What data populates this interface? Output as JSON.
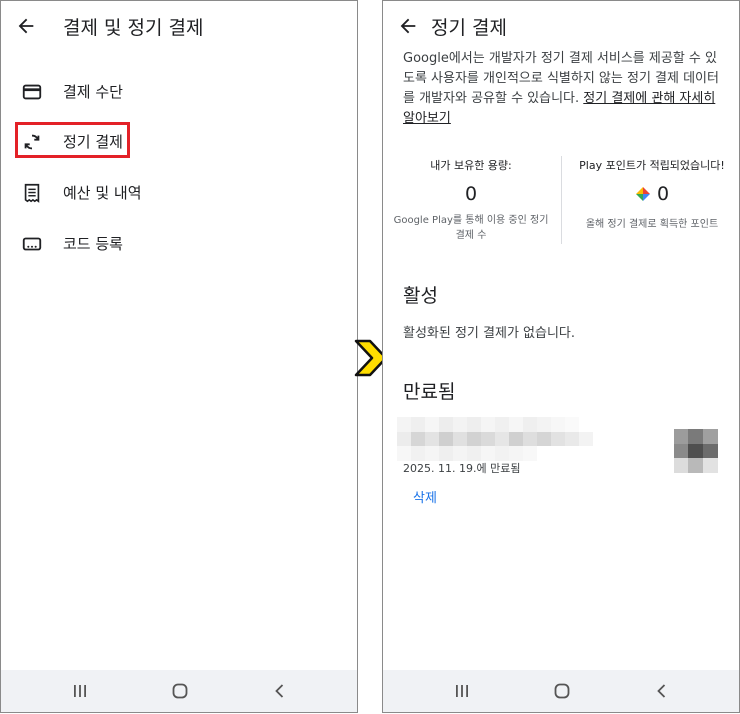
{
  "left": {
    "title": "결제 및 정기 결제",
    "menu": [
      {
        "label": "결제 수단",
        "icon": "credit-card-icon"
      },
      {
        "label": "정기 결제",
        "icon": "sync-icon"
      },
      {
        "label": "예산 및 내역",
        "icon": "receipt-icon"
      },
      {
        "label": "코드 등록",
        "icon": "redeem-code-icon"
      }
    ]
  },
  "right": {
    "title": "정기 결제",
    "description": "Google에서는 개발자가 정기 결제 서비스를 제공할 수 있도록 사용자를 개인적으로 식별하지 않는 정기 결제 데이터를 개발자와 공유할 수 있습니다.",
    "learn_more": "정기 결제에 관해 자세히 알아보기",
    "stats": {
      "owned_title": "내가 보유한 용량:",
      "owned_value": "0",
      "owned_sub": "Google Play를 통해 이용 중인 정기 결제 수",
      "points_title": "Play 포인트가 적립되었습니다!",
      "points_value": "0",
      "points_sub": "올해 정기 결제로 획득한 포인트"
    },
    "active_title": "활성",
    "active_empty": "활성화된 정기 결제가 없습니다.",
    "expired_title": "만료됨",
    "expired_item": {
      "date": "2025. 11. 19.에 만료됨",
      "delete_label": "삭제"
    }
  },
  "colors": {
    "highlight": "#e32128",
    "chevron_fill": "#ffdd00",
    "link": "#1a73e8",
    "navbar": "#f0f2f5"
  },
  "system_nav": [
    "recent-apps-icon",
    "home-icon",
    "back-icon"
  ]
}
